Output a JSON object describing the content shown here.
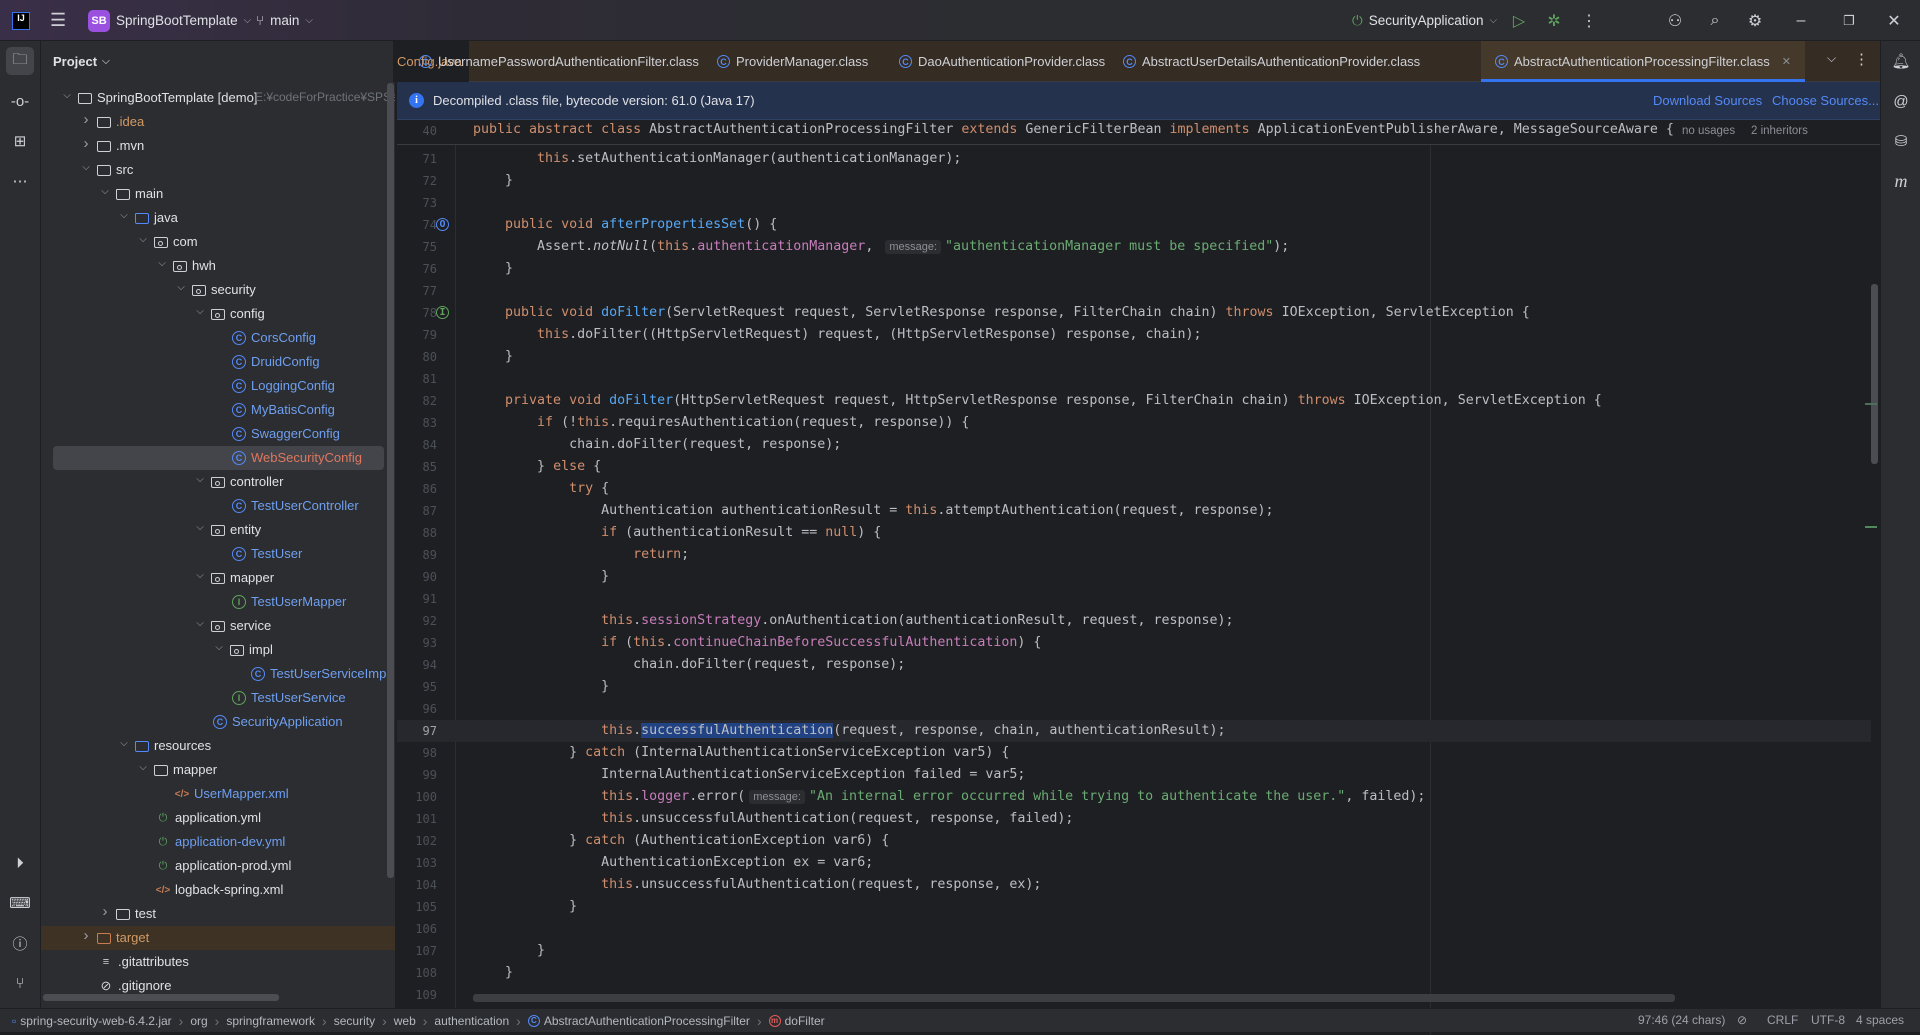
{
  "titlebar": {
    "project_badge": "SB",
    "project_name": "SpringBootTemplate",
    "branch": "main",
    "run_config": "SecurityApplication"
  },
  "project_panel": {
    "title": "Project",
    "tree": [
      {
        "depth": 0,
        "kind": "module",
        "label": "SpringBootTemplate [demo]",
        "path": "E:¥codeForPractice¥SPSecur",
        "arrow": "down",
        "color": "#dfe1e5"
      },
      {
        "depth": 1,
        "kind": "folder",
        "label": ".idea",
        "arrow": "right",
        "color": "#d19a66"
      },
      {
        "depth": 1,
        "kind": "folder",
        "label": ".mvn",
        "arrow": "right",
        "color": "#dfe1e5"
      },
      {
        "depth": 1,
        "kind": "folder",
        "label": "src",
        "arrow": "down",
        "color": "#dfe1e5"
      },
      {
        "depth": 2,
        "kind": "folder",
        "label": "main",
        "arrow": "down",
        "color": "#dfe1e5"
      },
      {
        "depth": 3,
        "kind": "folder-blue",
        "label": "java",
        "arrow": "down",
        "color": "#dfe1e5"
      },
      {
        "depth": 4,
        "kind": "package",
        "label": "com",
        "arrow": "down",
        "color": "#dfe1e5"
      },
      {
        "depth": 5,
        "kind": "package",
        "label": "hwh",
        "arrow": "down",
        "color": "#dfe1e5"
      },
      {
        "depth": 6,
        "kind": "package",
        "label": "security",
        "arrow": "down",
        "color": "#dfe1e5"
      },
      {
        "depth": 7,
        "kind": "package",
        "label": "config",
        "arrow": "down",
        "color": "#dfe1e5"
      },
      {
        "depth": 8,
        "kind": "class",
        "label": "CorsConfig",
        "color": "#6f9ff0"
      },
      {
        "depth": 8,
        "kind": "class",
        "label": "DruidConfig",
        "color": "#6f9ff0"
      },
      {
        "depth": 8,
        "kind": "class",
        "label": "LoggingConfig",
        "color": "#6f9ff0"
      },
      {
        "depth": 8,
        "kind": "class",
        "label": "MyBatisConfig",
        "color": "#6f9ff0"
      },
      {
        "depth": 8,
        "kind": "class",
        "label": "SwaggerConfig",
        "color": "#6f9ff0"
      },
      {
        "depth": 8,
        "kind": "class",
        "label": "WebSecurityConfig",
        "color": "#e0775f",
        "selected": true
      },
      {
        "depth": 7,
        "kind": "package",
        "label": "controller",
        "arrow": "down",
        "color": "#dfe1e5"
      },
      {
        "depth": 8,
        "kind": "class",
        "label": "TestUserController",
        "color": "#6f9ff0"
      },
      {
        "depth": 7,
        "kind": "package",
        "label": "entity",
        "arrow": "down",
        "color": "#dfe1e5"
      },
      {
        "depth": 8,
        "kind": "class",
        "label": "TestUser",
        "color": "#6f9ff0"
      },
      {
        "depth": 7,
        "kind": "package",
        "label": "mapper",
        "arrow": "down",
        "color": "#dfe1e5"
      },
      {
        "depth": 8,
        "kind": "interface",
        "label": "TestUserMapper",
        "color": "#6f9ff0"
      },
      {
        "depth": 7,
        "kind": "package",
        "label": "service",
        "arrow": "down",
        "color": "#dfe1e5"
      },
      {
        "depth": 8,
        "kind": "package",
        "label": "impl",
        "arrow": "down",
        "color": "#dfe1e5"
      },
      {
        "depth": 9,
        "kind": "class",
        "label": "TestUserServiceImpl",
        "color": "#6f9ff0"
      },
      {
        "depth": 8,
        "kind": "interface",
        "label": "TestUserService",
        "color": "#6f9ff0"
      },
      {
        "depth": 7,
        "kind": "spring-class",
        "label": "SecurityApplication",
        "color": "#6f9ff0"
      },
      {
        "depth": 3,
        "kind": "folder-blue",
        "label": "resources",
        "arrow": "down",
        "color": "#dfe1e5"
      },
      {
        "depth": 4,
        "kind": "folder",
        "label": "mapper",
        "arrow": "down",
        "color": "#dfe1e5"
      },
      {
        "depth": 5,
        "kind": "xml",
        "label": "UserMapper.xml",
        "color": "#6f9ff0"
      },
      {
        "depth": 4,
        "kind": "yml",
        "label": "application.yml",
        "color": "#dfe1e5"
      },
      {
        "depth": 4,
        "kind": "yml",
        "label": "application-dev.yml",
        "color": "#6f9ff0"
      },
      {
        "depth": 4,
        "kind": "yml",
        "label": "application-prod.yml",
        "color": "#dfe1e5"
      },
      {
        "depth": 4,
        "kind": "xml",
        "label": "logback-spring.xml",
        "color": "#dfe1e5"
      },
      {
        "depth": 2,
        "kind": "folder",
        "label": "test",
        "arrow": "right",
        "color": "#dfe1e5"
      },
      {
        "depth": 1,
        "kind": "folder-orange",
        "label": "target",
        "arrow": "right",
        "color": "#d19a66",
        "highlight": true
      },
      {
        "depth": 1,
        "kind": "text",
        "label": ".gitattributes",
        "color": "#dfe1e5"
      },
      {
        "depth": 1,
        "kind": "ignore",
        "label": ".gitignore",
        "color": "#dfe1e5"
      }
    ]
  },
  "tabs": [
    {
      "label": "Config.java",
      "icon": "none",
      "color": "#d19a66"
    },
    {
      "label": "UsernamePasswordAuthenticationFilter.class",
      "icon": "class"
    },
    {
      "label": "ProviderManager.class",
      "icon": "class"
    },
    {
      "label": "DaoAuthenticationProvider.class",
      "icon": "class"
    },
    {
      "label": "AbstractUserDetailsAuthenticationProvider.class",
      "icon": "class"
    },
    {
      "label": "AbstractAuthenticationProcessingFilter.class",
      "icon": "class",
      "active": true
    }
  ],
  "banner": {
    "text": "Decompiled .class file, bytecode version: 61.0 (Java 17)",
    "download_sources": "Download Sources",
    "choose_sources": "Choose Sources..."
  },
  "sticky": {
    "n": "40",
    "tokens": [
      [
        "public ",
        "k"
      ],
      [
        "abstract ",
        "k"
      ],
      [
        "class ",
        "k"
      ],
      [
        "AbstractAuthenticationProcessingFilter ",
        "t"
      ],
      [
        "extends ",
        "k"
      ],
      [
        "GenericFilterBean ",
        "t"
      ],
      [
        "implements ",
        "k"
      ],
      [
        "ApplicationEventPublisherAware, MessageSourceAware {",
        "t"
      ]
    ],
    "usages": "no usages",
    "inheritors": "2 inheritors"
  },
  "code": [
    {
      "n": "71",
      "tokens": [
        [
          "        ",
          "t"
        ],
        [
          "this",
          "k"
        ],
        [
          ".setAuthenticationManager(authenticationManager);",
          "t"
        ]
      ]
    },
    {
      "n": "72",
      "tokens": [
        [
          "    }",
          "t"
        ]
      ]
    },
    {
      "n": "73",
      "tokens": []
    },
    {
      "n": "74",
      "gutter": "override",
      "tokens": [
        [
          "    public ",
          "k"
        ],
        [
          "void ",
          "k"
        ],
        [
          "afterPropertiesSet",
          "m"
        ],
        [
          "() {",
          "t"
        ]
      ]
    },
    {
      "n": "75",
      "tokens": [
        [
          "        Assert.",
          "t"
        ],
        [
          "notNull",
          "i"
        ],
        [
          "(",
          "t"
        ],
        [
          "this",
          "k"
        ],
        [
          ".",
          "t"
        ],
        [
          "authenticationManager",
          "f"
        ],
        [
          ", ",
          "t"
        ],
        [
          "message:",
          "h"
        ],
        [
          "\"authenticationManager must be specified\"",
          "s"
        ],
        [
          ");",
          "t"
        ]
      ]
    },
    {
      "n": "76",
      "tokens": [
        [
          "    }",
          "t"
        ]
      ]
    },
    {
      "n": "77",
      "tokens": []
    },
    {
      "n": "78",
      "gutter": "implements",
      "tokens": [
        [
          "    public ",
          "k"
        ],
        [
          "void ",
          "k"
        ],
        [
          "doFilter",
          "m"
        ],
        [
          "(ServletRequest request, ServletResponse response, FilterChain chain) ",
          "t"
        ],
        [
          "throws ",
          "k"
        ],
        [
          "IOException, ServletException {",
          "t"
        ]
      ]
    },
    {
      "n": "79",
      "tokens": [
        [
          "        ",
          "t"
        ],
        [
          "this",
          "k"
        ],
        [
          ".doFilter((HttpServletRequest) request, (HttpServletResponse) response, chain);",
          "t"
        ]
      ]
    },
    {
      "n": "80",
      "tokens": [
        [
          "    }",
          "t"
        ]
      ]
    },
    {
      "n": "81",
      "tokens": []
    },
    {
      "n": "82",
      "tokens": [
        [
          "    private ",
          "k"
        ],
        [
          "void ",
          "k"
        ],
        [
          "doFilter",
          "m"
        ],
        [
          "(HttpServletRequest request, HttpServletResponse response, FilterChain chain) ",
          "t"
        ],
        [
          "throws ",
          "k"
        ],
        [
          "IOException, ServletException {",
          "t"
        ]
      ]
    },
    {
      "n": "83",
      "tokens": [
        [
          "        ",
          "t"
        ],
        [
          "if ",
          "k"
        ],
        [
          "(!",
          "t"
        ],
        [
          "this",
          "k"
        ],
        [
          ".requiresAuthentication(request, response)) {",
          "t"
        ]
      ]
    },
    {
      "n": "84",
      "tokens": [
        [
          "            chain.doFilter(request, response);",
          "t"
        ]
      ]
    },
    {
      "n": "85",
      "tokens": [
        [
          "        } ",
          "t"
        ],
        [
          "else ",
          "k"
        ],
        [
          "{",
          "t"
        ]
      ]
    },
    {
      "n": "86",
      "tokens": [
        [
          "            ",
          "t"
        ],
        [
          "try ",
          "k"
        ],
        [
          "{",
          "t"
        ]
      ]
    },
    {
      "n": "87",
      "tokens": [
        [
          "                Authentication authenticationResult = ",
          "t"
        ],
        [
          "this",
          "k"
        ],
        [
          ".attemptAuthentication(request, response);",
          "t"
        ]
      ]
    },
    {
      "n": "88",
      "tokens": [
        [
          "                ",
          "t"
        ],
        [
          "if ",
          "k"
        ],
        [
          "(authenticationResult == ",
          "t"
        ],
        [
          "null",
          "k"
        ],
        [
          ") {",
          "t"
        ]
      ]
    },
    {
      "n": "89",
      "tokens": [
        [
          "                    ",
          "t"
        ],
        [
          "return",
          "k"
        ],
        [
          ";",
          "t"
        ]
      ]
    },
    {
      "n": "90",
      "tokens": [
        [
          "                }",
          "t"
        ]
      ]
    },
    {
      "n": "91",
      "tokens": []
    },
    {
      "n": "92",
      "tokens": [
        [
          "                ",
          "t"
        ],
        [
          "this",
          "k"
        ],
        [
          ".",
          "t"
        ],
        [
          "sessionStrategy",
          "f"
        ],
        [
          ".onAuthentication(authenticationResult, request, response);",
          "t"
        ]
      ]
    },
    {
      "n": "93",
      "tokens": [
        [
          "                ",
          "t"
        ],
        [
          "if ",
          "k"
        ],
        [
          "(",
          "t"
        ],
        [
          "this",
          "k"
        ],
        [
          ".",
          "t"
        ],
        [
          "continueChainBeforeSuccessfulAuthentication",
          "f"
        ],
        [
          ") {",
          "t"
        ]
      ]
    },
    {
      "n": "94",
      "tokens": [
        [
          "                    chain.doFilter(request, response);",
          "t"
        ]
      ]
    },
    {
      "n": "95",
      "tokens": [
        [
          "                }",
          "t"
        ]
      ]
    },
    {
      "n": "96",
      "tokens": []
    },
    {
      "n": "97",
      "current": true,
      "tokens": [
        [
          "                ",
          "t"
        ],
        [
          "this",
          "k"
        ],
        [
          ".",
          "t"
        ],
        [
          "successfulAuthentication",
          "sel"
        ],
        [
          "(request, response, chain, authenticationResult);",
          "t"
        ]
      ]
    },
    {
      "n": "98",
      "tokens": [
        [
          "            } ",
          "t"
        ],
        [
          "catch ",
          "k"
        ],
        [
          "(InternalAuthenticationServiceException var5) {",
          "t"
        ]
      ]
    },
    {
      "n": "99",
      "tokens": [
        [
          "                InternalAuthenticationServiceException failed = var5;",
          "t"
        ]
      ]
    },
    {
      "n": "100",
      "tokens": [
        [
          "                ",
          "t"
        ],
        [
          "this",
          "k"
        ],
        [
          ".",
          "t"
        ],
        [
          "logger",
          "f"
        ],
        [
          ".error(",
          "t"
        ],
        [
          "message:",
          "h"
        ],
        [
          "\"An internal error occurred while trying to authenticate the user.\"",
          "s"
        ],
        [
          ", failed);",
          "t"
        ]
      ]
    },
    {
      "n": "101",
      "tokens": [
        [
          "                ",
          "t"
        ],
        [
          "this",
          "k"
        ],
        [
          ".unsuccessfulAuthentication(request, response, failed);",
          "t"
        ]
      ]
    },
    {
      "n": "102",
      "tokens": [
        [
          "            } ",
          "t"
        ],
        [
          "catch ",
          "k"
        ],
        [
          "(AuthenticationException var6) {",
          "t"
        ]
      ]
    },
    {
      "n": "103",
      "tokens": [
        [
          "                AuthenticationException ex = var6;",
          "t"
        ]
      ]
    },
    {
      "n": "104",
      "tokens": [
        [
          "                ",
          "t"
        ],
        [
          "this",
          "k"
        ],
        [
          ".unsuccessfulAuthentication(request, response, ex);",
          "t"
        ]
      ]
    },
    {
      "n": "105",
      "tokens": [
        [
          "            }",
          "t"
        ]
      ]
    },
    {
      "n": "106",
      "tokens": []
    },
    {
      "n": "107",
      "tokens": [
        [
          "        }",
          "t"
        ]
      ]
    },
    {
      "n": "108",
      "tokens": [
        [
          "    }",
          "t"
        ]
      ]
    },
    {
      "n": "109",
      "tokens": []
    }
  ],
  "statusbar": {
    "breadcrumbs": [
      "spring-security-web-6.4.2.jar",
      "org",
      "springframework",
      "security",
      "web",
      "authentication",
      "AbstractAuthenticationProcessingFilter",
      "doFilter"
    ],
    "position": "97:46 (24 chars)",
    "line_ending": "CRLF",
    "encoding": "UTF-8",
    "indent": "4 spaces"
  },
  "colors": {
    "accent": "#3574f0",
    "keyword": "#cf8e6d",
    "method": "#56a8f5",
    "field": "#c77dbb",
    "string": "#6aab73",
    "selection": "#214283"
  }
}
